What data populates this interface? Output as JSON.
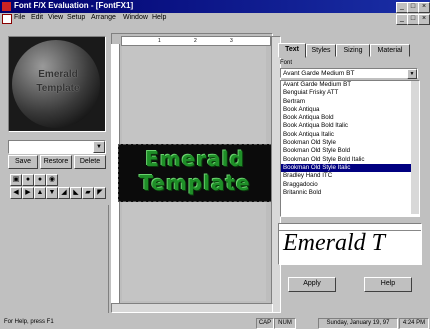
{
  "window": {
    "title": "Font F/X Evaluation - [FontFX1]",
    "buttons": [
      "_",
      "□",
      "×"
    ],
    "child_buttons": [
      "_",
      "□",
      "×"
    ]
  },
  "menu": [
    "File",
    "Edit",
    "View",
    "Setup",
    "Arrange",
    "Window",
    "Help"
  ],
  "preview": {
    "lines": [
      "Emerald",
      "Template"
    ]
  },
  "left_panel": {
    "save": "Save",
    "restore": "Restore",
    "delete": "Delete"
  },
  "canvas": {
    "text_lines": [
      "Emerald",
      "Template"
    ],
    "ruler_ticks": [
      "1",
      "2",
      "3"
    ]
  },
  "tabs": [
    "Text",
    "Styles",
    "Sizing",
    "Material"
  ],
  "font_panel": {
    "label": "Font",
    "selected": "Avant Garde Medium BT",
    "list": [
      "Avant Garde Medium BT",
      "Benguiat Frisky ATT",
      "Bertram",
      "Book Antiqua",
      "Book Antiqua Bold",
      "Book Antiqua Bold Italic",
      "Book Antiqua Italic",
      "Bookman Old Style",
      "Bookman Old Style Bold",
      "Bookman Old Style Bold Italic",
      "Bookman Old Style Italic",
      "Bradley Hand ITC",
      "Braggadocio",
      "Britannic Bold"
    ],
    "highlighted_index": 10,
    "sample_text": "Emerald T"
  },
  "actions": {
    "apply": "Apply",
    "help": "Help"
  },
  "status": {
    "help": "For Help, press F1",
    "cap": "CAP",
    "num": "NUM",
    "date": "Sunday, January 19, 97",
    "time": "4:24 PM"
  },
  "colors": {
    "title_bar": "#00006e",
    "selection": "#000080",
    "emerald_text": "#1f8f28"
  }
}
